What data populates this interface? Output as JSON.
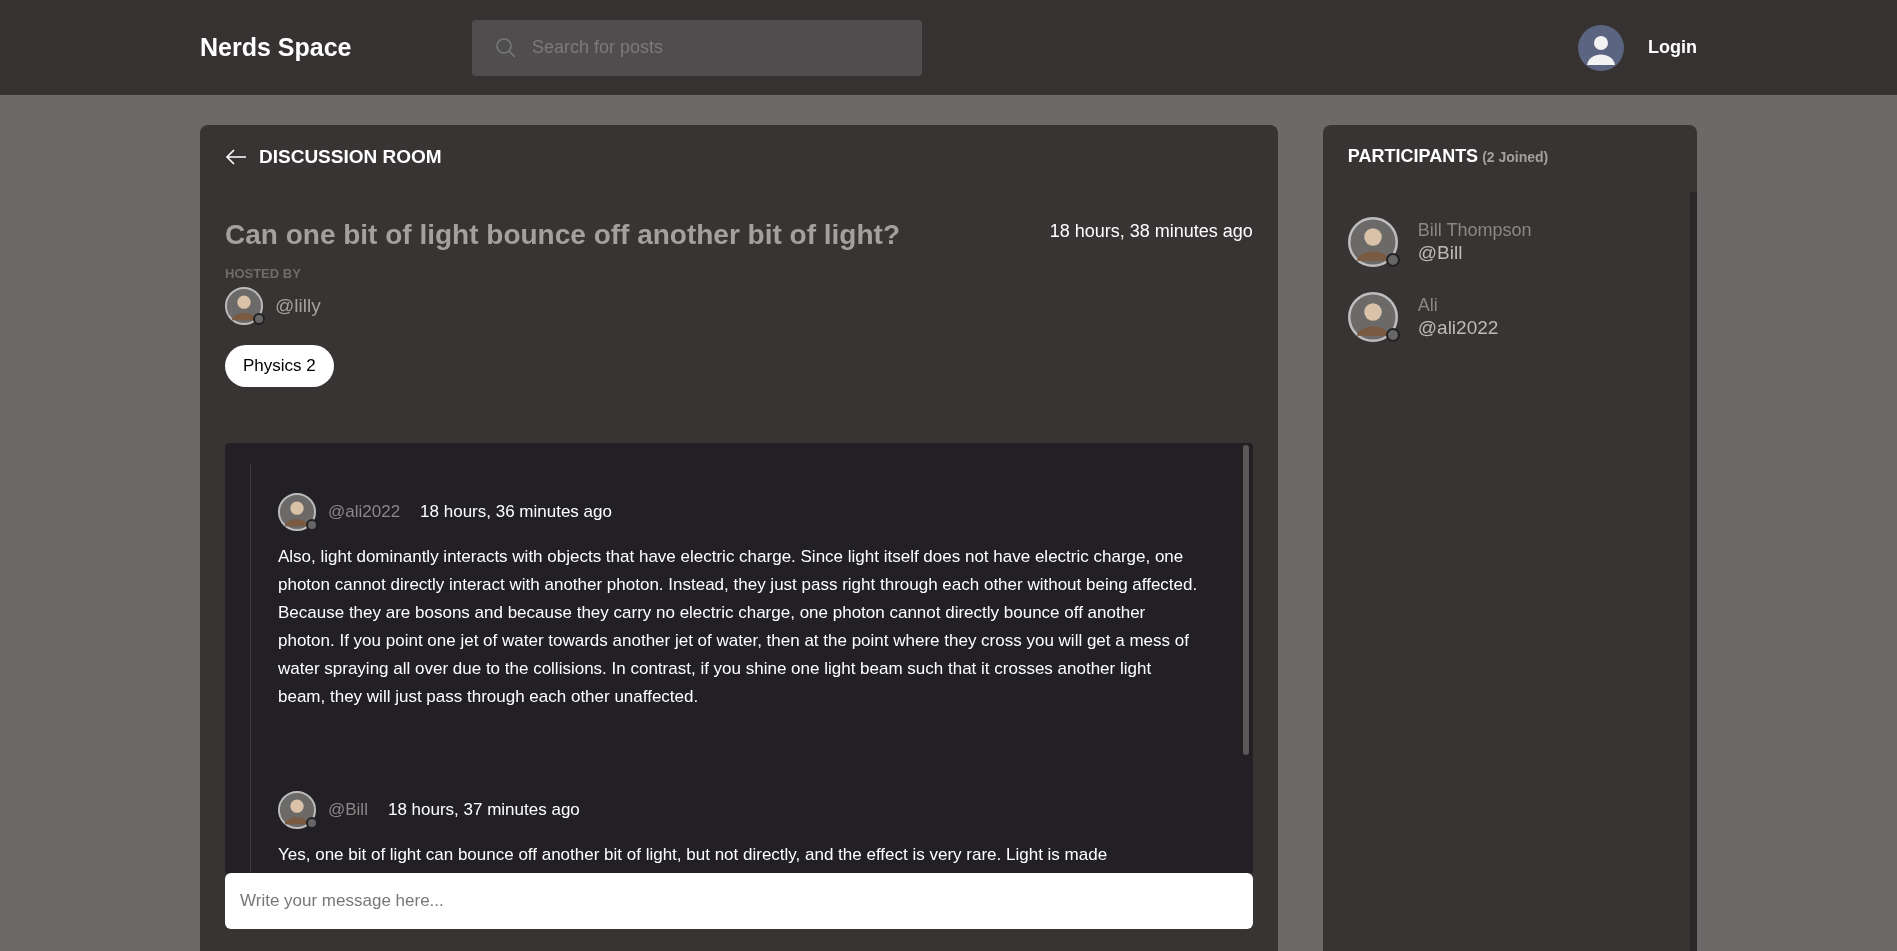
{
  "header": {
    "logo": "Nerds Space",
    "search": {
      "placeholder": "Search for posts"
    },
    "login": "Login"
  },
  "room": {
    "back_title": "DISCUSSION ROOM",
    "title": "Can one bit of light bounce off another bit of light?",
    "time": "18 hours, 38 minutes ago",
    "hosted_by_label": "HOSTED BY",
    "host": "@lilly",
    "topic": "Physics 2",
    "messages": [
      {
        "user": "@ali2022",
        "time": "18 hours, 36 minutes ago",
        "body": "Also, light dominantly interacts with objects that have electric charge. Since light itself does not have electric charge, one photon cannot directly interact with another photon. Instead, they just pass right through each other without being affected. Because they are bosons and because they carry no electric charge, one photon cannot directly bounce off another photon. If you point one jet of water towards another jet of water, then at the point where they cross you will get a mess of water spraying all over due to the collisions. In contrast, if you shine one light beam such that it crosses another light beam, they will just pass through each other unaffected."
      },
      {
        "user": "@Bill",
        "time": "18 hours, 37 minutes ago",
        "body": "Yes, one bit of light can bounce off another bit of light, but not directly, and the effect is very rare. Light is made"
      }
    ],
    "composer": {
      "placeholder": "Write your message here..."
    }
  },
  "participants": {
    "title": "PARTICIPANTS",
    "count": "(2 Joined)",
    "items": [
      {
        "name": "Bill Thompson",
        "handle": "@Bill"
      },
      {
        "name": "Ali",
        "handle": "@ali2022"
      }
    ]
  }
}
